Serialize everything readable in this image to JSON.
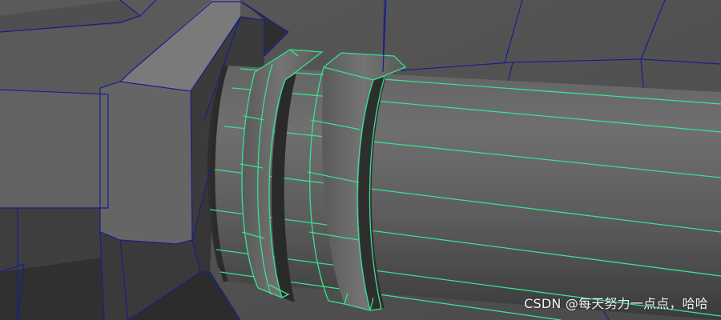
{
  "viewport": {
    "background_color": "#4d4d4d",
    "selected_wire_color": "#36e28f",
    "unselected_wire_color": "#1a1f8a"
  },
  "watermark": {
    "text": "CSDN @每天努力一点点，哈哈"
  }
}
